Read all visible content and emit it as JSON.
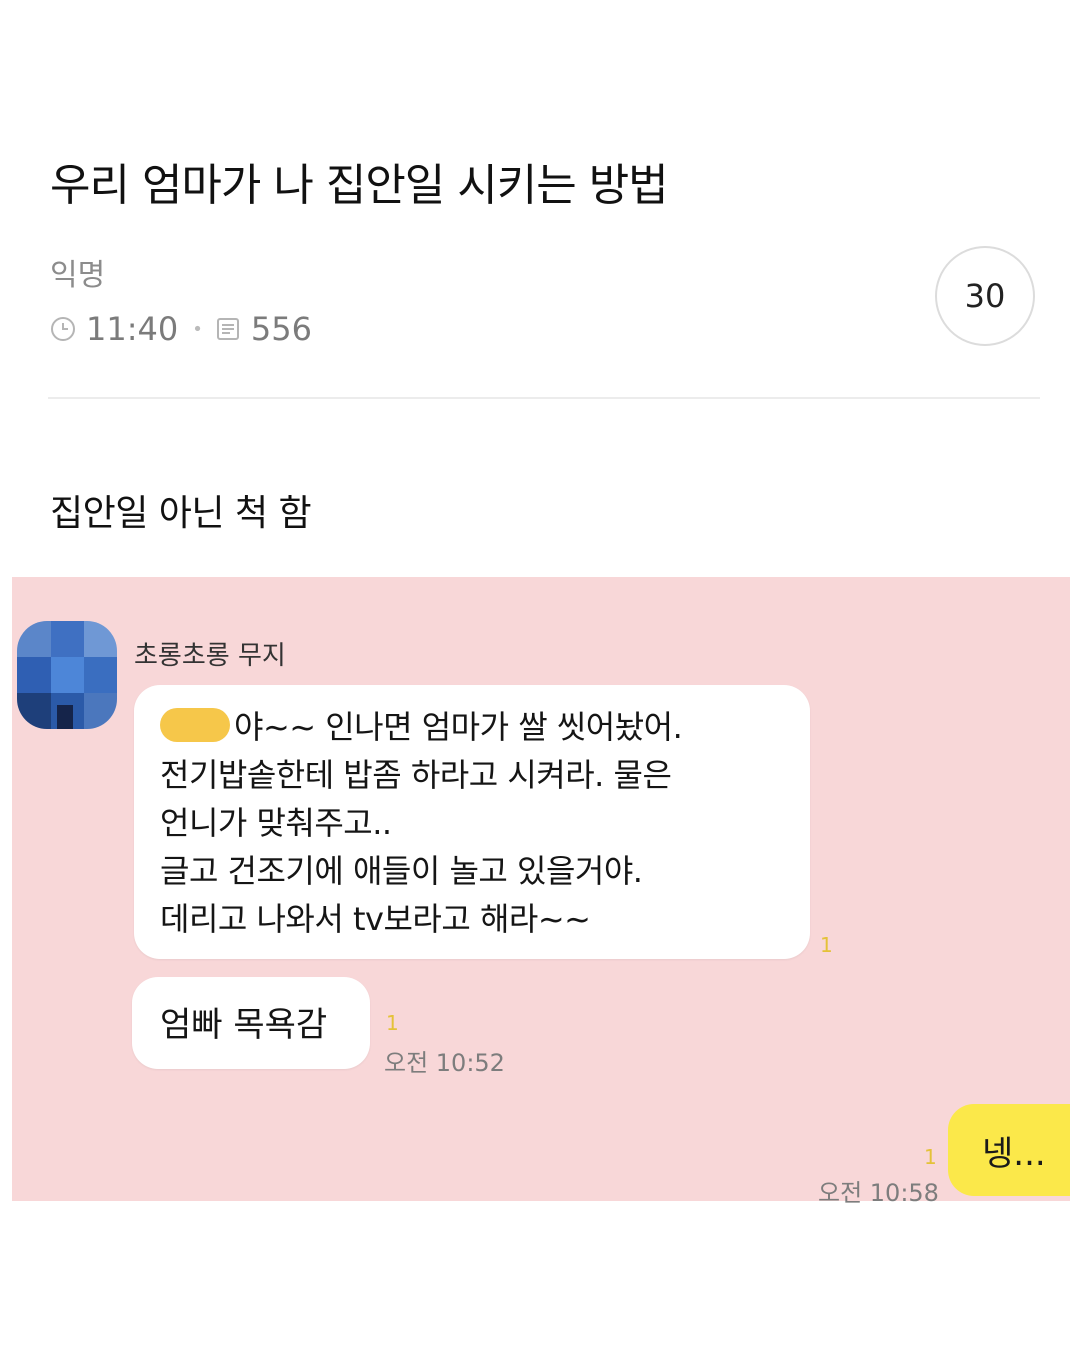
{
  "post": {
    "title": "우리 엄마가 나 집안일 시키는 방법",
    "author": "익명",
    "time": "11:40",
    "views": "556",
    "comment_count": "30",
    "body": "집안일 아닌 척 함"
  },
  "chat": {
    "background": "#f8d7d8",
    "sender": "초롱초롱 무지",
    "messages": {
      "main_line1_rest": "야~~ 인나면 엄마가 쌀 씻어놨어.",
      "main_line2": "전기밥솥한테 밥좀 하라고 시켜라. 물은",
      "main_line3": "언니가 맞춰주고..",
      "main_line4": "글고 건조기에 애들이 놀고 있을거야.",
      "main_line5": "데리고 나와서 tv보라고 해라~~",
      "second": "엄빠 목욕감",
      "second_time": "오전 10:52",
      "mine": "넹...",
      "mine_time": "오전 10:58"
    },
    "unread_marks": [
      "1",
      "1",
      "1"
    ]
  },
  "icons": {
    "clock": "clock-icon",
    "views": "document-icon"
  },
  "colors": {
    "my_bubble": "#fbe84a",
    "censor": "#f6c74a"
  }
}
